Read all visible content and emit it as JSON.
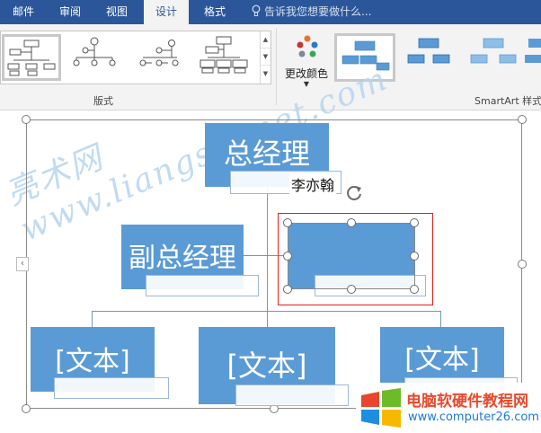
{
  "ribbon": {
    "tabs": [
      {
        "label": "邮件",
        "active": false
      },
      {
        "label": "审阅",
        "active": false
      },
      {
        "label": "视图",
        "active": false
      },
      {
        "label": "设计",
        "active": true
      },
      {
        "label": "格式",
        "active": false
      }
    ],
    "tell_me": "告诉我您想要做什么...",
    "layouts_group_label": "版式",
    "change_colors_label": "更改颜色",
    "styles_group_label": "SmartArt 样式"
  },
  "diagram": {
    "top_node": "总经理",
    "assistant_node": "副总经理",
    "name_label": "李亦翰",
    "selected_node": "",
    "child_nodes": [
      "[文本]",
      "[文本]",
      "[文本]"
    ]
  },
  "watermark": "亮术网 www.liangshunet.com",
  "logo": {
    "line1": "电脑软硬件教程网",
    "line2": "www.computer26.com"
  },
  "colors": {
    "tab_bar": "#2b579a",
    "node_fill": "#5b9bd5",
    "selection_outline": "#e02020"
  }
}
